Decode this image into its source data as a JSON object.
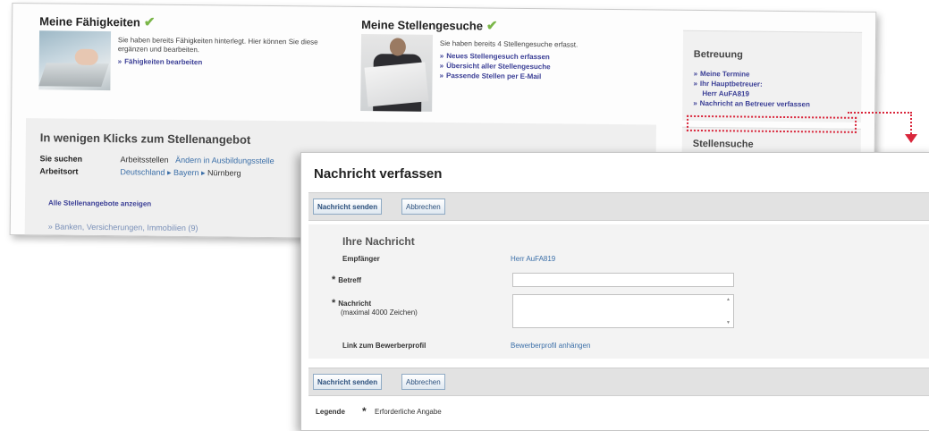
{
  "profile": {
    "skills": {
      "title": "Meine Fähigkeiten",
      "check_icon": "check-icon",
      "text": "Sie haben bereits Fähigkeiten hinterlegt. Hier können Sie diese ergänzen und bearbeiten.",
      "link": "Fähigkeiten bearbeiten"
    },
    "search": {
      "title": "Meine Stellengesuche",
      "check_icon": "check-icon",
      "text": "Sie haben bereits 4 Stellengesuche erfasst.",
      "links": [
        "Neues Stellengesuch erfassen",
        "Übersicht aller Stellengesuche",
        "Passende Stellen per E-Mail"
      ]
    }
  },
  "quick": {
    "title": "In wenigen Klicks zum Stellenangebot",
    "seek_label": "Sie suchen",
    "seek_value": "Arbeitsstellen",
    "seek_change": "Ändern in Ausbildungsstelle",
    "place_label": "Arbeitsort",
    "place_parts": [
      "Deutschland",
      "Bayern",
      "Nürnberg"
    ],
    "all_offers": "Alle Stellenangebote anzeigen",
    "category": "Banken, Versicherungen, Immobilien (9)"
  },
  "sidebar": {
    "care_title": "Betreuung",
    "care_links": [
      "Meine Termine",
      "Ihr Hauptbetreuer:"
    ],
    "advisor_name": "Herr AuFA819",
    "compose_link": "Nachricht an Betreuer verfassen",
    "search_title": "Stellensuche"
  },
  "dialog": {
    "title": "Nachricht verfassen",
    "send_label": "Nachricht senden",
    "cancel_label": "Abbrechen",
    "form_heading": "Ihre Nachricht",
    "recipient_label": "Empfänger",
    "recipient_value": "Herr AuFA819",
    "subject_label": "Betreff",
    "subject_value": "",
    "message_label": "Nachricht",
    "message_hint": "(maximal 4000 Zeichen)",
    "message_value": "",
    "profile_link_label": "Link zum Bewerberprofil",
    "profile_link_value": "Bewerberprofil anhängen",
    "legend_label": "Legende",
    "legend_star": "*",
    "legend_text": "Erforderliche Angabe"
  },
  "colors": {
    "accent_link": "#3b3f96",
    "highlight": "#d9263b",
    "check": "#7ab648"
  }
}
